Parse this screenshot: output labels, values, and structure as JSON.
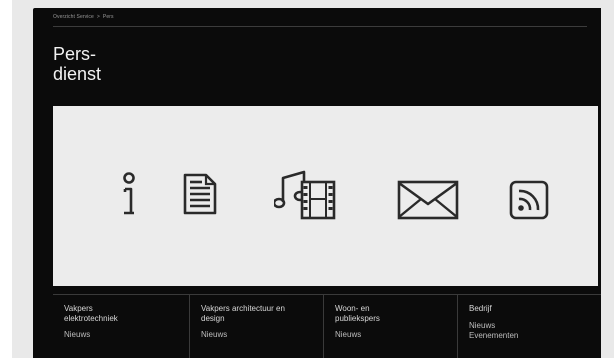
{
  "breadcrumb": {
    "parent": "Overzicht Service",
    "separator": ">",
    "current": "Pers"
  },
  "title": {
    "line1": "Pers-",
    "line2": "dienst"
  },
  "icons": [
    {
      "name": "info-icon"
    },
    {
      "name": "document-icon"
    },
    {
      "name": "music-film-icon"
    },
    {
      "name": "envelope-icon"
    },
    {
      "name": "rss-icon"
    }
  ],
  "columns": [
    {
      "head": "Vakpers elektrotechniek",
      "links": [
        "Nieuws"
      ]
    },
    {
      "head": "Vakpers architectuur en design",
      "links": [
        "Nieuws"
      ]
    },
    {
      "head": "Woon- en publiekspers",
      "links": [
        "Nieuws"
      ]
    },
    {
      "head": "Bedrijf",
      "links": [
        "Nieuws",
        "Evenementen"
      ]
    }
  ],
  "colors": {
    "background": "#0b0b0b",
    "panel": "#ececec",
    "icon_stroke": "#2a2a2a"
  }
}
